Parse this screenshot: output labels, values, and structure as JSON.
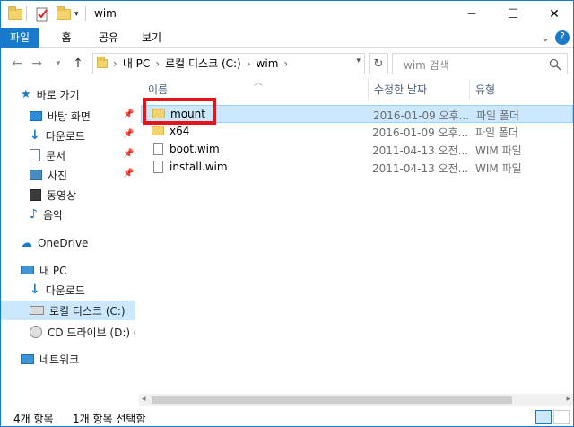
{
  "window": {
    "title": "wim",
    "minimize": "─",
    "maximize": "☐",
    "close": "✕"
  },
  "ribbon": {
    "tabs": [
      "파일",
      "홈",
      "공유",
      "보기"
    ],
    "expand_icon": "⌄",
    "help_icon": "?"
  },
  "address": {
    "crumbs": [
      "내 PC",
      "로컬 디스크 (C:)",
      "wim"
    ],
    "search_placeholder": "wim 검색"
  },
  "nav": {
    "quick_access": "바로 가기",
    "items": [
      {
        "label": "바탕 화면",
        "pinned": true
      },
      {
        "label": "다운로드",
        "pinned": true
      },
      {
        "label": "문서",
        "pinned": true
      },
      {
        "label": "사진",
        "pinned": true
      },
      {
        "label": "동영상",
        "pinned": false
      },
      {
        "label": "음악",
        "pinned": false
      }
    ],
    "onedrive": "OneDrive",
    "this_pc": "내 PC",
    "pc_items": [
      "다운로드",
      "로컬 디스크 (C:)",
      "CD 드라이브 (D:) G"
    ],
    "network": "네트워크"
  },
  "columns": {
    "name": "이름",
    "date": "수정한 날짜",
    "type": "유형"
  },
  "files": [
    {
      "name": "mount",
      "date": "2016-01-09 오후...",
      "type": "파일 폴더",
      "kind": "folder"
    },
    {
      "name": "x64",
      "date": "2016-01-09 오후...",
      "type": "파일 폴더",
      "kind": "folder"
    },
    {
      "name": "boot.wim",
      "date": "2011-04-13 오전...",
      "type": "WIM 파일",
      "kind": "file"
    },
    {
      "name": "install.wim",
      "date": "2011-04-13 오전...",
      "type": "WIM 파일",
      "kind": "file"
    }
  ],
  "status": {
    "count": "4개 항목",
    "selected": "1개 항목 선택함"
  },
  "colors": {
    "accent": "#1979ca",
    "selection": "#cce8ff",
    "highlight": "#e2141c"
  }
}
